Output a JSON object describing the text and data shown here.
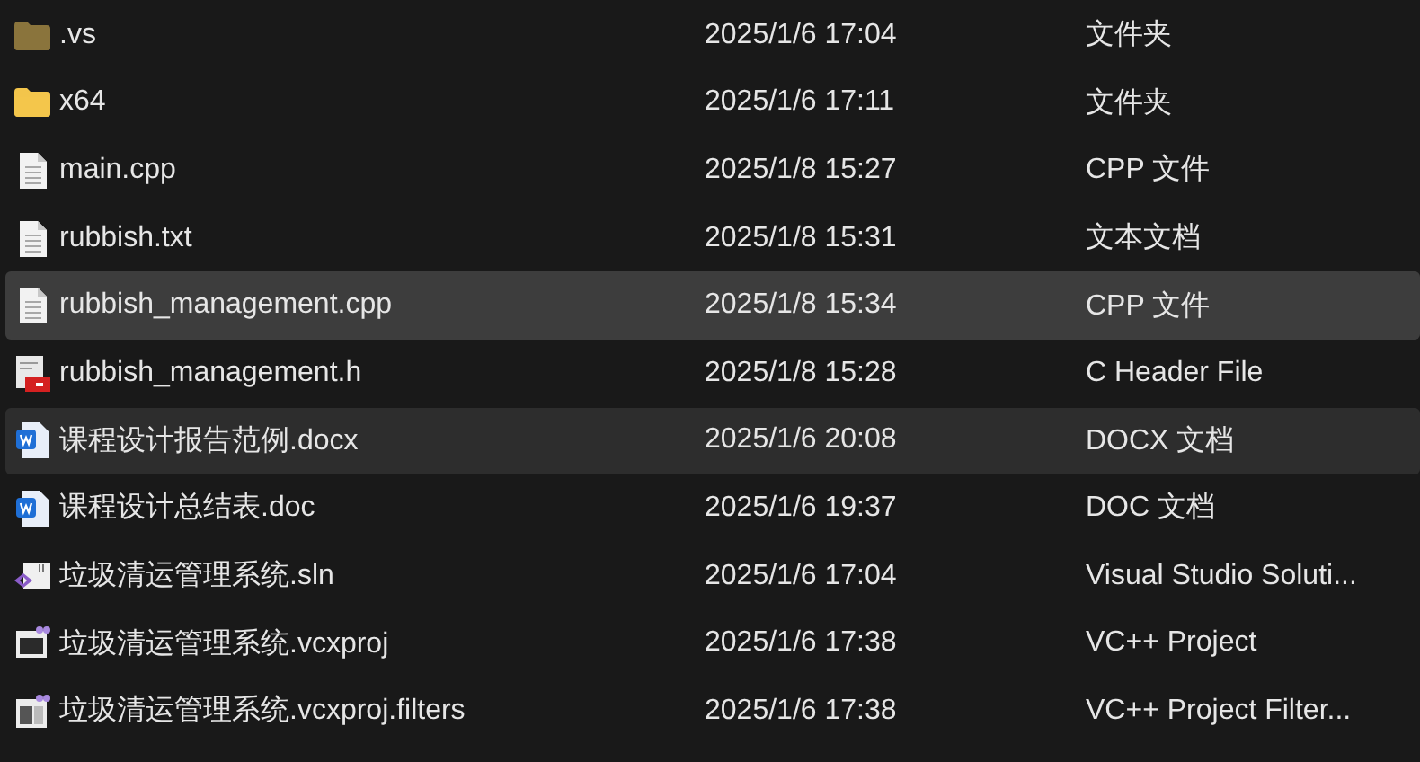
{
  "files": [
    {
      "kind": "hiddenfolder",
      "name": ".vs",
      "modified": "2025/1/6 17:04",
      "type": "文件夹",
      "selected": false,
      "hovered": false
    },
    {
      "kind": "folder",
      "name": "x64",
      "modified": "2025/1/6 17:11",
      "type": "文件夹",
      "selected": false,
      "hovered": false
    },
    {
      "kind": "text",
      "name": "main.cpp",
      "modified": "2025/1/8 15:27",
      "type": "CPP 文件",
      "selected": false,
      "hovered": false
    },
    {
      "kind": "text",
      "name": "rubbish.txt",
      "modified": "2025/1/8 15:31",
      "type": "文本文档",
      "selected": false,
      "hovered": false
    },
    {
      "kind": "text",
      "name": "rubbish_management.cpp",
      "modified": "2025/1/8 15:34",
      "type": "CPP 文件",
      "selected": true,
      "hovered": false
    },
    {
      "kind": "header",
      "name": "rubbish_management.h",
      "modified": "2025/1/8 15:28",
      "type": "C Header File",
      "selected": false,
      "hovered": false
    },
    {
      "kind": "word",
      "name": "课程设计报告范例.docx",
      "modified": "2025/1/6 20:08",
      "type": "DOCX 文档",
      "selected": false,
      "hovered": true
    },
    {
      "kind": "word",
      "name": "课程设计总结表.doc",
      "modified": "2025/1/6 19:37",
      "type": "DOC 文档",
      "selected": false,
      "hovered": false
    },
    {
      "kind": "solution",
      "name": "垃圾清运管理系统.sln",
      "modified": "2025/1/6 17:04",
      "type": "Visual Studio Soluti...",
      "selected": false,
      "hovered": false
    },
    {
      "kind": "project",
      "name": "垃圾清运管理系统.vcxproj",
      "modified": "2025/1/6 17:38",
      "type": "VC++ Project",
      "selected": false,
      "hovered": false
    },
    {
      "kind": "filters",
      "name": "垃圾清运管理系统.vcxproj.filters",
      "modified": "2025/1/6 17:38",
      "type": "VC++ Project Filter...",
      "selected": false,
      "hovered": false
    }
  ]
}
